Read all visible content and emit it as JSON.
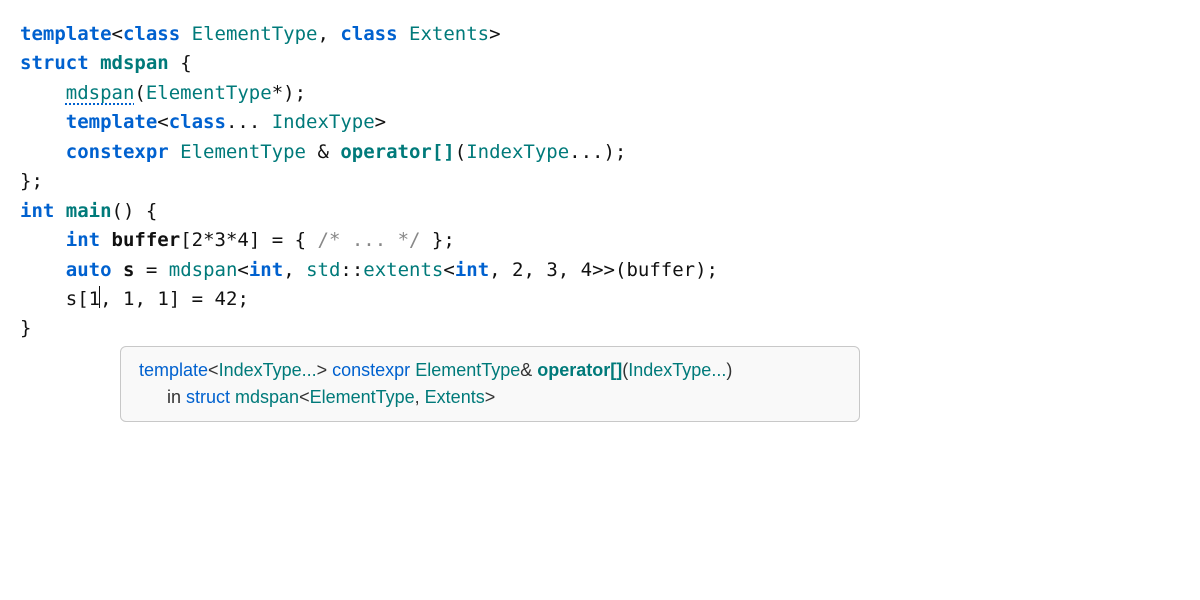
{
  "code": {
    "l1": {
      "template": "template",
      "lt": "<",
      "class1": "class",
      "sp1": " ",
      "etype": "ElementType",
      "comma": ", ",
      "class2": "class",
      "sp2": " ",
      "extents": "Extents",
      "gt": ">"
    },
    "l2": {
      "struct": "struct",
      "sp": " ",
      "name": "mdspan",
      "sp2": " ",
      "brace": "{"
    },
    "l3": {
      "indent": "    ",
      "ctor": "mdspan",
      "open": "(",
      "etype": "ElementType",
      "star": "*",
      "close": ");"
    },
    "l4": "",
    "l5": {
      "indent": "    ",
      "template": "template",
      "lt": "<",
      "class": "class",
      "dots": "... ",
      "itype": "IndexType",
      "gt": ">"
    },
    "l6": {
      "indent": "    ",
      "constexpr": "constexpr",
      "sp": " ",
      "etype": "ElementType",
      "amp": " & ",
      "op": "operator",
      "brk": "[]",
      "open": "(",
      "itype": "IndexType",
      "dots": "...",
      "close": ");"
    },
    "l7": "};",
    "l8": "",
    "l9": {
      "int": "int",
      "sp": " ",
      "main": "main",
      "paren": "()",
      "sp2": " ",
      "brace": "{"
    },
    "l10": {
      "indent": "    ",
      "int": "int",
      "sp": " ",
      "buf": "buffer",
      "open": "[",
      "expr": "2*3*4",
      "close": "]",
      "eq": " = { ",
      "cmt": "/* ... */",
      "end": " };"
    },
    "l11": {
      "indent": "    ",
      "auto": "auto",
      "sp": " ",
      "s": "s",
      "eq": " = ",
      "mdspan": "mdspan",
      "lt": "<",
      "int": "int",
      "comma": ", ",
      "std": "std",
      "cc": "::",
      "ext": "extents",
      "lt2": "<",
      "int2": "int",
      "args": ", 2, 3, 4",
      "gt2": ">>",
      "open": "(",
      "buf": "buffer",
      "close": ");"
    },
    "l12": {
      "indent": "    ",
      "s": "s",
      "open": "[",
      "first": "1",
      "rest": ", 1, 1",
      "close": "]",
      "eq": " = ",
      "val": "42",
      "semi": ";"
    },
    "l13": "}"
  },
  "tooltip": {
    "template": "template",
    "lt": "<",
    "itype": "IndexType...",
    "gt": "> ",
    "constexpr": "constexpr ",
    "etype": "ElementType",
    "amp": "& ",
    "op": "operator[]",
    "open": "(",
    "arg": "IndexType...",
    "close": ")",
    "line2_in": "in ",
    "line2_struct": "struct ",
    "line2_name": "mdspan",
    "line2_lt": "<",
    "line2_e": "ElementType",
    "line2_c": ", ",
    "line2_x": "Extents",
    "line2_gt": ">"
  }
}
